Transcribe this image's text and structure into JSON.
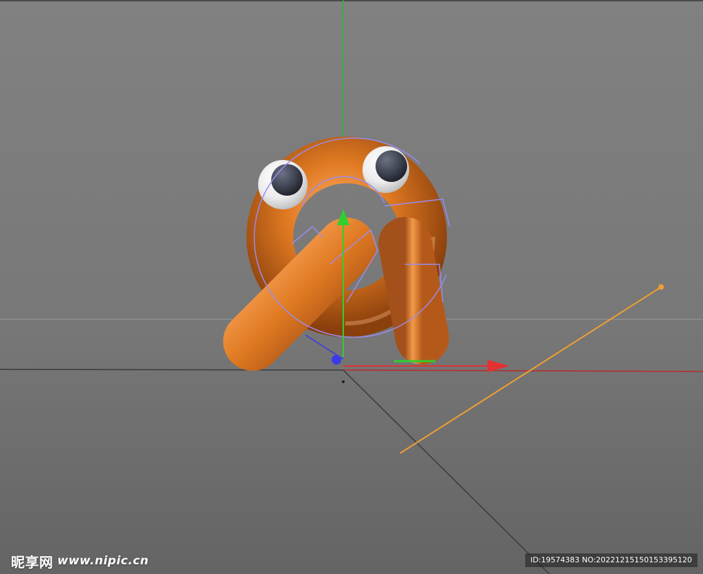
{
  "viewport": {
    "background_top": "#818181",
    "background_bottom": "#676767"
  },
  "colors": {
    "object_orange": "#e07a22",
    "object_orange_highlight": "#ffb06a",
    "object_orange_shadow": "#8a3f0c",
    "eye_white": "#f2f2f2",
    "pupil": "#3d4250",
    "selection_outline": "#9a8cf0",
    "axis_x": "#e23131",
    "axis_y": "#2fd02f",
    "axis_z": "#3a3ae8",
    "spline": "#f0a030",
    "horizon": "#8e8e8e"
  },
  "icons": {
    "x_axis_handle": "x-axis-arrow-icon",
    "y_axis_handle": "y-axis-arrow-icon",
    "z_axis_handle": "z-axis-dot-icon",
    "spline_point": "spline-point-icon"
  },
  "watermark": {
    "brand": "昵享网",
    "url": "www.nipic.cn",
    "id_text": "ID:19574383 NO:20221215150153395120"
  }
}
